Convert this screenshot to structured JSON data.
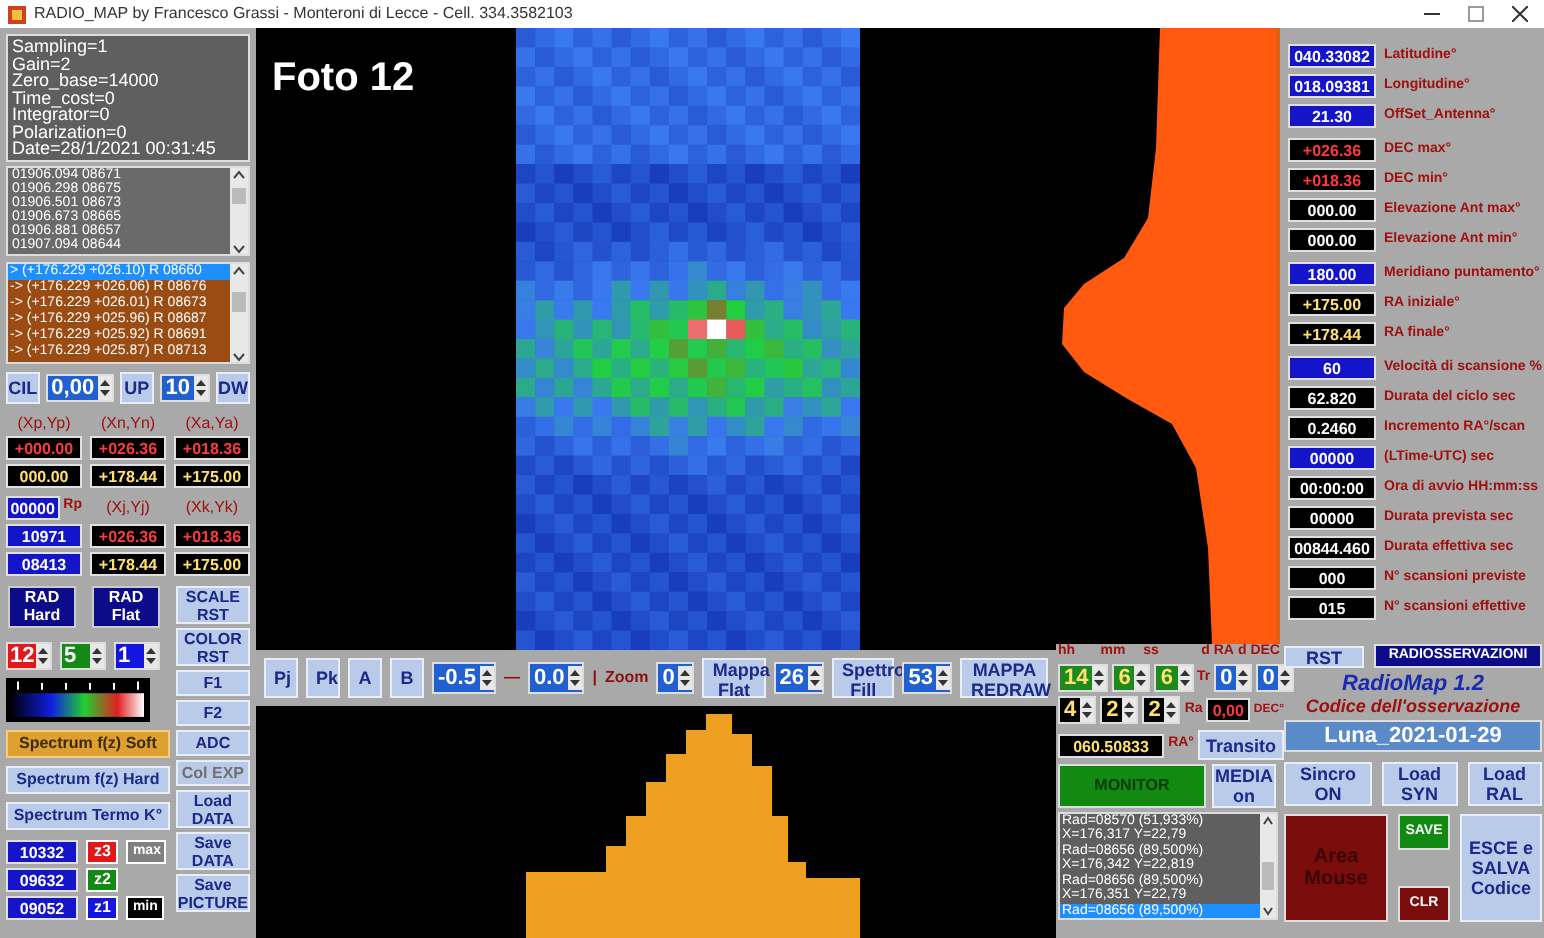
{
  "title_bar": {
    "title": "RADIO_MAP by Francesco Grassi - Monteroni di Lecce - Cell. 334.3582103"
  },
  "left": {
    "info": [
      "Sampling=1",
      "Gain=2",
      "Zero_base=14000",
      "Time_cost=0",
      "Integrator=0",
      "Polarization=0",
      "Date=28/1/2021 00:31:45"
    ],
    "readings": [
      "01906.094 08671",
      "01906.298 08675",
      "01906.501 08673",
      "01906.673 08665",
      "01906.881 08657",
      "01907.094 08644"
    ],
    "positions": [
      {
        "text": "> (+176.229 +026.10) R 08660",
        "selected": true
      },
      {
        "text": "-> (+176.229 +026.06) R 08676",
        "selected": false
      },
      {
        "text": "-> (+176.229 +026.01) R 08673",
        "selected": false
      },
      {
        "text": "-> (+176.229 +025.96) R 08687",
        "selected": false
      },
      {
        "text": "-> (+176.229 +025.92) R 08691",
        "selected": false
      },
      {
        "text": "-> (+176.229 +025.87) R 08713",
        "selected": false
      }
    ],
    "cil": {
      "cil_button": "CIL",
      "step": "0,00",
      "up_button": "UP",
      "count": "10",
      "dw_button": "DW"
    },
    "coord_headers": [
      "(Xp,Yp)",
      "(Xn,Yn)",
      "(Xa,Ya)"
    ],
    "coord_rows": [
      [
        {
          "value": "+000.00",
          "kind": "red"
        },
        {
          "value": "+026.36",
          "kind": "red"
        },
        {
          "value": "+018.36",
          "kind": "red"
        }
      ],
      [
        {
          "value": "000.00",
          "kind": "yellow"
        },
        {
          "value": "+178.44",
          "kind": "yellow"
        },
        {
          "value": "+175.00",
          "kind": "yellow"
        }
      ]
    ],
    "rp": {
      "value": "00000",
      "kind": "blue",
      "label": "Rp"
    },
    "coord_headers2": [
      "(Xj,Yj)",
      "(Xk,Yk)"
    ],
    "coord_rows2": [
      [
        {
          "value": "10971",
          "kind": "blue"
        },
        {
          "value": "+026.36",
          "kind": "red"
        },
        {
          "value": "+018.36",
          "kind": "red"
        }
      ],
      [
        {
          "value": "08413",
          "kind": "blue"
        },
        {
          "value": "+178.44",
          "kind": "yellow"
        },
        {
          "value": "+175.00",
          "kind": "yellow"
        }
      ]
    ],
    "rad_buttons": [
      "RAD Hard",
      "RAD Flat"
    ],
    "color_spinners": [
      {
        "value": "12",
        "color": "#e01818"
      },
      {
        "value": "5",
        "color": "#138a13"
      },
      {
        "value": "1",
        "color": "#1515e0"
      }
    ],
    "spectrum_modes": [
      {
        "label": "Spectrum f(z) Soft",
        "selected": true
      },
      {
        "label": "Spectrum f(z) Hard",
        "selected": false
      },
      {
        "label": "Spectrum Termo K°",
        "selected": false
      }
    ],
    "levels": [
      {
        "value": "10332",
        "tag": "z3",
        "color": "#e01818",
        "extra": "max",
        "kind": "grey"
      },
      {
        "value": "09632",
        "tag": "z2",
        "color": "#138a13"
      },
      {
        "value": "09052",
        "tag": "z1",
        "color": "#1515e0",
        "extra": "min",
        "kind": "black"
      }
    ],
    "side_buttons": [
      {
        "label": "SCALE RST",
        "disabled": false,
        "kind": "tall"
      },
      {
        "label": "COLOR RST",
        "disabled": false,
        "kind": "tall"
      },
      {
        "label": "F1",
        "disabled": false,
        "kind": "short"
      },
      {
        "label": "F2",
        "disabled": false,
        "kind": "short"
      },
      {
        "label": "ADC",
        "disabled": false,
        "kind": "short"
      },
      {
        "label": "Col EXP",
        "disabled": true,
        "kind": "short"
      },
      {
        "label": "Load DATA",
        "disabled": false,
        "kind": "tall"
      },
      {
        "label": "Save DATA",
        "disabled": false,
        "kind": "tall"
      },
      {
        "label": "Save PICTURE",
        "disabled": false,
        "kind": "tall"
      }
    ]
  },
  "map": {
    "caption": "Foto 12"
  },
  "toolbar": {
    "items": [
      {
        "kind": "button",
        "label": "Pj"
      },
      {
        "kind": "button",
        "label": "Pk"
      },
      {
        "kind": "button",
        "label": "A"
      },
      {
        "kind": "button",
        "label": "B"
      },
      {
        "kind": "spin",
        "value": "-0.5"
      },
      {
        "kind": "text",
        "label": "—"
      },
      {
        "kind": "spin",
        "value": "0.0"
      },
      {
        "kind": "text",
        "label": "|"
      },
      {
        "kind": "text",
        "label": "Zoom"
      },
      {
        "kind": "spin",
        "value": "0"
      },
      {
        "kind": "button",
        "label": "Mappa Flat"
      },
      {
        "kind": "spin",
        "value": "26"
      },
      {
        "kind": "button",
        "label": "Spettro Fill"
      },
      {
        "kind": "spin",
        "value": "53"
      },
      {
        "kind": "button",
        "label": "MAPPA REDRAW"
      }
    ]
  },
  "parameters": {
    "groups": [
      [
        {
          "value": "040.33082",
          "kind": "blue",
          "label": "Latitudine°"
        },
        {
          "value": "018.09381",
          "kind": "blue",
          "label": "Longitudine°"
        },
        {
          "value": "21.30",
          "kind": "blue",
          "label": "OffSet_Antenna°"
        }
      ],
      [
        {
          "value": "+026.36",
          "kind": "red",
          "label": "DEC max°"
        },
        {
          "value": "+018.36",
          "kind": "red",
          "label": "DEC min°"
        },
        {
          "value": "000.00",
          "kind": "white",
          "label": "Elevazione Ant max°"
        },
        {
          "value": "000.00",
          "kind": "white",
          "label": "Elevazione Ant min°"
        }
      ],
      [
        {
          "value": "180.00",
          "kind": "blue",
          "label": "Meridiano puntamento°"
        },
        {
          "value": "+175.00",
          "kind": "yellow",
          "label": "RA iniziale°"
        },
        {
          "value": "+178.44",
          "kind": "yellow",
          "label": "RA finale°"
        }
      ],
      [
        {
          "value": "60",
          "kind": "blue",
          "label": "Velocità di scansione %"
        },
        {
          "value": "62.820",
          "kind": "white",
          "label": "Durata del ciclo sec"
        },
        {
          "value": "0.2460",
          "kind": "white",
          "label": "Incremento RA°/scan"
        },
        {
          "value": "00000",
          "kind": "blue",
          "label": "(LTime-UTC) sec"
        },
        {
          "value": "00:00:00",
          "kind": "white",
          "label": "Ora di avvio HH:mm:ss"
        },
        {
          "value": "00000",
          "kind": "white",
          "label": "Durata prevista sec"
        },
        {
          "value": "00844.460",
          "kind": "white",
          "label": "Durata effettiva sec"
        },
        {
          "value": "000",
          "kind": "white",
          "label": "N° scansioni previste"
        },
        {
          "value": "015",
          "kind": "white",
          "label": "N° scansioni effettive"
        }
      ]
    ]
  },
  "time": {
    "headers": [
      "hh",
      "mm",
      "ss"
    ],
    "offset_headers": [
      "d RA",
      "d DEC"
    ],
    "top": [
      {
        "value": "14",
        "kind": "green"
      },
      {
        "value": "6",
        "kind": "green"
      },
      {
        "value": "6",
        "kind": "green"
      }
    ],
    "top_label": "Tr",
    "offsets": [
      "0",
      "0"
    ],
    "bottom": [
      {
        "value": "4",
        "kind": "black"
      },
      {
        "value": "2",
        "kind": "black"
      },
      {
        "value": "2",
        "kind": "black"
      }
    ],
    "bottom_label": "Ra",
    "ra_value": "0,00",
    "dec_label": "DEC°",
    "transit_value": "060.50833",
    "transit_label": "RA°",
    "transit_button": "Transito",
    "monitor_button": "MONITOR",
    "media_button": "MEDIA on"
  },
  "log": [
    {
      "text": "Rad=08570 (51,933%)",
      "selected": false
    },
    {
      "text": "X=176,317 Y=22,79",
      "selected": false
    },
    {
      "text": "Rad=08656 (89,500%)",
      "selected": false
    },
    {
      "text": "X=176,342 Y=22,819",
      "selected": false
    },
    {
      "text": "Rad=08656 (89,500%)",
      "selected": false
    },
    {
      "text": "X=176,351 Y=22,79",
      "selected": false
    },
    {
      "text": "Rad=08656 (89,500%)",
      "selected": true
    }
  ],
  "session": {
    "rst_button": "RST",
    "radio_button": "RADIOSSERVAZIONI",
    "app_name": "RadioMap 1.2",
    "code_label": "Codice dell'osservazione",
    "code_value": "Luna_2021-01-29",
    "buttons": [
      {
        "label": "Sincro ON"
      },
      {
        "label": "Load SYN"
      },
      {
        "label": "Load RAL"
      }
    ],
    "area_button": "Area Mouse",
    "save_button": "SAVE",
    "clr_button": "CLR",
    "exit_button": "ESCE e SALVA Codice"
  }
}
